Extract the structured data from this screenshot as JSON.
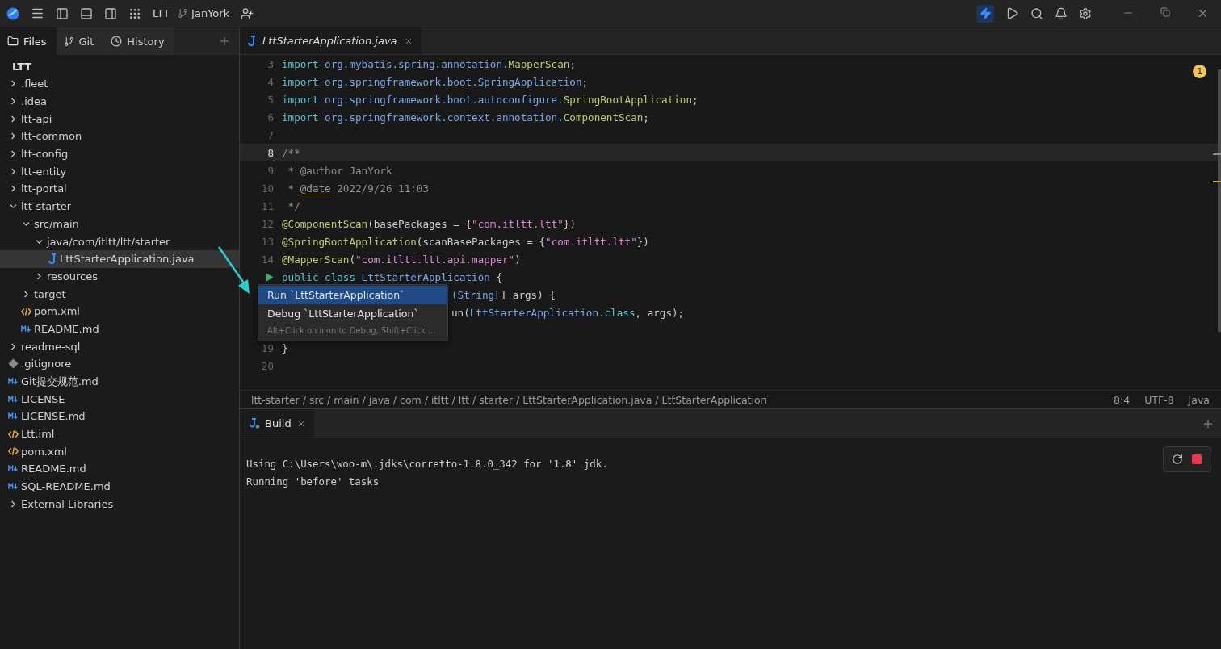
{
  "titlebar": {
    "project": "LTT",
    "branch": "JanYork"
  },
  "sidebar": {
    "tabs": [
      {
        "label": "Files",
        "kind": "files",
        "selected": true
      },
      {
        "label": "Git",
        "kind": "git",
        "selected": false
      },
      {
        "label": "History",
        "kind": "history",
        "selected": false
      }
    ],
    "project": "LTT",
    "tree": [
      {
        "label": ".fleet",
        "kind": "folder",
        "expanded": false,
        "selected": false
      },
      {
        "label": ".idea",
        "kind": "folder",
        "expanded": false,
        "selected": false
      },
      {
        "label": "ltt-api",
        "kind": "folder",
        "expanded": false,
        "selected": false
      },
      {
        "label": "ltt-common",
        "kind": "folder",
        "expanded": false,
        "selected": false
      },
      {
        "label": "ltt-config",
        "kind": "folder",
        "expanded": false,
        "selected": false
      },
      {
        "label": "ltt-entity",
        "kind": "folder",
        "expanded": false,
        "selected": false
      },
      {
        "label": "ltt-portal",
        "kind": "folder",
        "expanded": false,
        "selected": false
      },
      {
        "label": "ltt-starter",
        "kind": "folder",
        "expanded": true,
        "selected": false,
        "children": [
          {
            "label": "src/main",
            "kind": "folder",
            "expanded": true,
            "selected": false,
            "children": [
              {
                "label": "java/com/itltt/ltt/starter",
                "kind": "folder",
                "expanded": true,
                "selected": false,
                "children": [
                  {
                    "label": "LttStarterApplication.java",
                    "kind": "java",
                    "selected": true
                  }
                ]
              },
              {
                "label": "resources",
                "kind": "folder",
                "expanded": false,
                "selected": false
              }
            ]
          },
          {
            "label": "target",
            "kind": "folder",
            "expanded": false,
            "selected": false
          },
          {
            "label": "pom.xml",
            "kind": "xml",
            "selected": false
          },
          {
            "label": "README.md",
            "kind": "md",
            "selected": false
          }
        ]
      },
      {
        "label": "readme-sql",
        "kind": "folder",
        "expanded": false,
        "selected": false
      },
      {
        "label": ".gitignore",
        "kind": "git",
        "selected": false
      },
      {
        "label": "Git提交规范.md",
        "kind": "md",
        "selected": false
      },
      {
        "label": "LICENSE",
        "kind": "md",
        "selected": false
      },
      {
        "label": "LICENSE.md",
        "kind": "md",
        "selected": false
      },
      {
        "label": "Ltt.iml",
        "kind": "xml",
        "selected": false
      },
      {
        "label": "pom.xml",
        "kind": "xml",
        "selected": false
      },
      {
        "label": "README.md",
        "kind": "md",
        "selected": false
      },
      {
        "label": "SQL-README.md",
        "kind": "md",
        "selected": false
      },
      {
        "label": "External Libraries",
        "kind": "folder",
        "expanded": false,
        "selected": false
      }
    ]
  },
  "editor": {
    "tab": {
      "label": "LttStarterApplication.java"
    },
    "warnings": "1",
    "lines": [
      {
        "number": "3",
        "kind": "code",
        "current": false,
        "tokens": [
          {
            "kind": "keyword",
            "text": "import "
          },
          {
            "kind": "package",
            "text": "org.mybatis.spring.annotation."
          },
          {
            "kind": "type",
            "text": "MapperScan"
          },
          {
            "kind": "plain",
            "text": ";"
          }
        ]
      },
      {
        "number": "4",
        "kind": "code",
        "current": false,
        "tokens": [
          {
            "kind": "keyword",
            "text": "import "
          },
          {
            "kind": "package",
            "text": "org.springframework.boot.SpringApplication"
          },
          {
            "kind": "plain",
            "text": ";"
          }
        ]
      },
      {
        "number": "5",
        "kind": "code",
        "current": false,
        "tokens": [
          {
            "kind": "keyword",
            "text": "import "
          },
          {
            "kind": "package",
            "text": "org.springframework.boot.autoconfigure."
          },
          {
            "kind": "type",
            "text": "SpringBootApplication"
          },
          {
            "kind": "plain",
            "text": ";"
          }
        ]
      },
      {
        "number": "6",
        "kind": "code",
        "current": false,
        "tokens": [
          {
            "kind": "keyword",
            "text": "import "
          },
          {
            "kind": "package",
            "text": "org.springframework.context.annotation."
          },
          {
            "kind": "type",
            "text": "ComponentScan"
          },
          {
            "kind": "plain",
            "text": ";"
          }
        ]
      },
      {
        "number": "7",
        "kind": "code",
        "current": false
      },
      {
        "number": "8",
        "kind": "code",
        "current": true,
        "tokens": [
          {
            "kind": "comment",
            "text": "/**"
          }
        ]
      },
      {
        "number": "9",
        "kind": "code",
        "current": false,
        "tokens": [
          {
            "kind": "comment",
            "text": " * @author JanYork"
          }
        ]
      },
      {
        "number": "10",
        "kind": "code",
        "current": false,
        "tokens": [
          {
            "kind": "comment",
            "text": " * "
          },
          {
            "kind": "doctag",
            "text": "@date"
          },
          {
            "kind": "comment",
            "text": " 2022/9/26 11:03"
          }
        ]
      },
      {
        "number": "11",
        "kind": "code",
        "current": false,
        "tokens": [
          {
            "kind": "comment",
            "text": " */"
          }
        ]
      },
      {
        "number": "12",
        "kind": "code",
        "current": false,
        "tokens": [
          {
            "kind": "type",
            "text": "@ComponentScan"
          },
          {
            "kind": "plain",
            "text": "(basePackages = {"
          },
          {
            "kind": "string",
            "text": "\"com.itltt.ltt\""
          },
          {
            "kind": "plain",
            "text": "})"
          }
        ]
      },
      {
        "number": "13",
        "kind": "code",
        "current": false,
        "tokens": [
          {
            "kind": "type",
            "text": "@SpringBootApplication"
          },
          {
            "kind": "plain",
            "text": "(scanBasePackages = {"
          },
          {
            "kind": "string",
            "text": "\"com.itltt.ltt\""
          },
          {
            "kind": "plain",
            "text": "})"
          }
        ]
      },
      {
        "number": "14",
        "kind": "code",
        "current": false,
        "tokens": [
          {
            "kind": "type",
            "text": "@MapperScan"
          },
          {
            "kind": "plain",
            "text": "("
          },
          {
            "kind": "string",
            "text": "\"com.itltt.ltt.api.mapper\""
          },
          {
            "kind": "plain",
            "text": ")"
          }
        ]
      },
      {
        "kind": "run",
        "current": false,
        "tokens": [
          {
            "kind": "keyword",
            "text": "public class "
          },
          {
            "kind": "package",
            "text": "LttStarterApplication"
          },
          {
            "kind": "plain",
            "text": " {"
          }
        ]
      },
      {
        "kind": "partial",
        "current": false,
        "tokens": [
          {
            "kind": "package",
            "text": "(String"
          },
          {
            "kind": "plain",
            "text": "[] args) {"
          }
        ]
      },
      {
        "kind": "partial",
        "current": false,
        "tokens": [
          {
            "kind": "plain",
            "text": "un("
          },
          {
            "kind": "package",
            "text": "LttStarterApplication"
          },
          {
            "kind": "keyword",
            "text": ".class"
          },
          {
            "kind": "plain",
            "text": ", args);"
          }
        ]
      },
      {
        "kind": "covered",
        "current": false
      },
      {
        "number": "19",
        "kind": "code",
        "current": false,
        "tokens": [
          {
            "kind": "plain",
            "text": "}"
          }
        ]
      },
      {
        "number": "20",
        "kind": "code",
        "current": false
      }
    ],
    "popup": {
      "items": [
        {
          "label": "Run `LttStarterApplication`",
          "selected": true
        },
        {
          "label": "Debug `LttStarterApplication`",
          "selected": false
        }
      ],
      "hint": "Alt+Click on icon to Debug, Shift+Click ..."
    },
    "breadcrumb": "ltt-starter / src / main / java / com / itltt / ltt / starter / LttStarterApplication.java / LttStarterApplication",
    "status": {
      "position": "8:4",
      "encoding": "UTF-8",
      "language": "Java"
    }
  },
  "build_panel": {
    "tab": {
      "label": "Build"
    },
    "output": [
      "Using C:\\Users\\woo-m\\.jdks\\corretto-1.8.0_342 for '1.8' jdk.",
      "Running 'before' tasks"
    ]
  }
}
